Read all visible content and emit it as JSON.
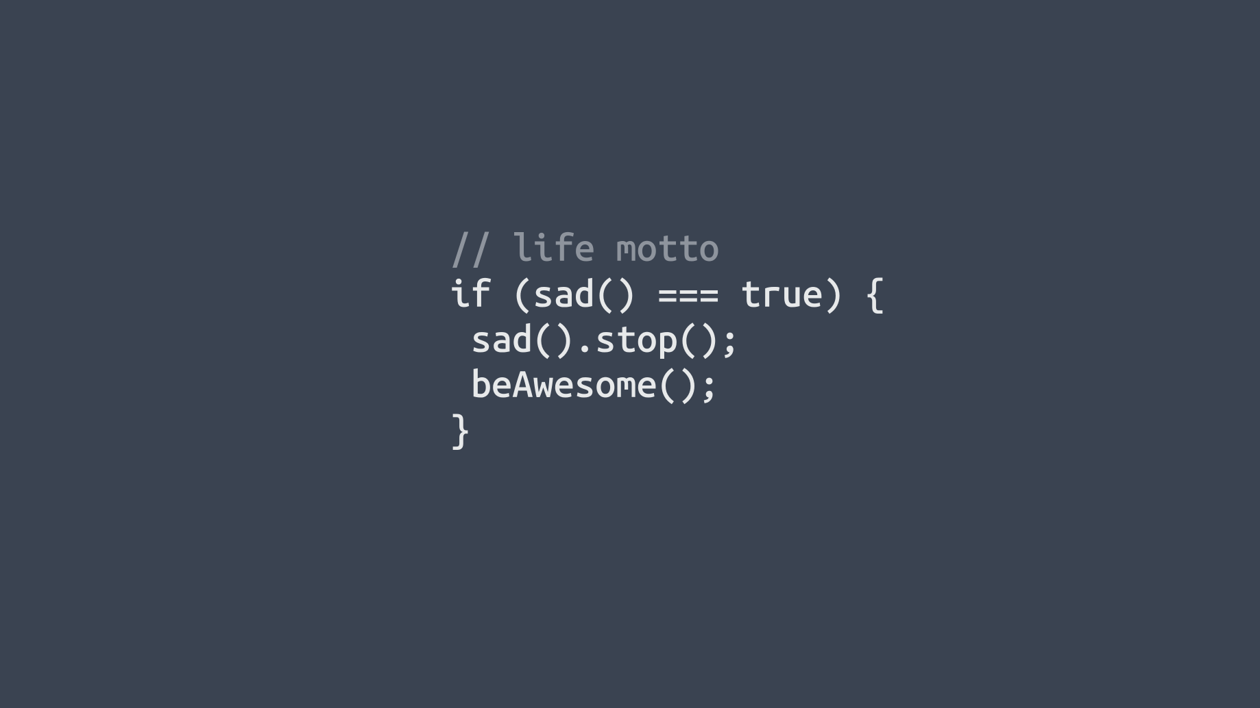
{
  "code": {
    "comment": "// life motto",
    "line1": "if (sad() === true) {",
    "line2": " sad().stop();",
    "line3": " beAwesome();",
    "line4": "}"
  },
  "colors": {
    "background": "#3a4351",
    "comment": "#8e949d",
    "code": "#e7e9ea"
  }
}
